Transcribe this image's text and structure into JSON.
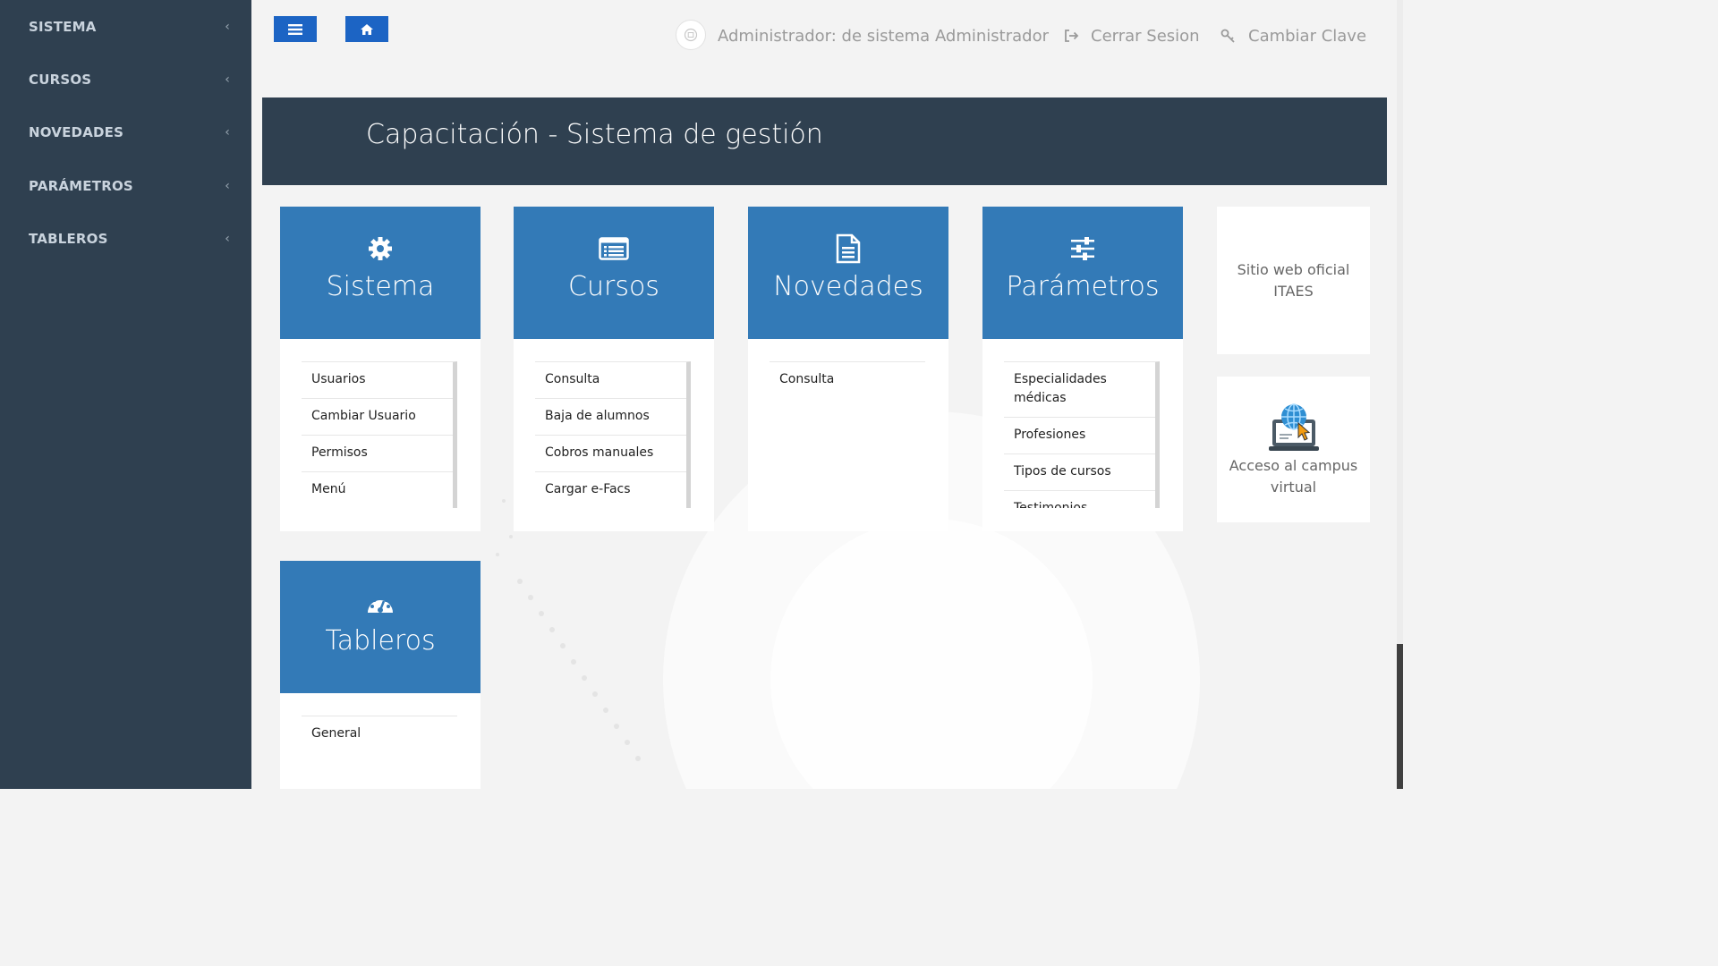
{
  "sidebar": {
    "items": [
      {
        "label": "SISTEMA"
      },
      {
        "label": "CURSOS"
      },
      {
        "label": "NOVEDADES"
      },
      {
        "label": "PARÁMETROS"
      },
      {
        "label": "TABLEROS"
      }
    ],
    "chevron": "‹"
  },
  "topbar": {
    "menu_icon": "bars-icon",
    "home_icon": "home-icon",
    "user_label": "Administrador: de sistema Administrador",
    "logout_label": "Cerrar Sesion",
    "change_password_label": "Cambiar Clave"
  },
  "header": {
    "title": "Capacitación - Sistema de gestión"
  },
  "modules": [
    {
      "title": "Sistema",
      "icon": "gear-icon",
      "items": [
        "Usuarios",
        "Cambiar Usuario",
        "Permisos",
        "Menú"
      ]
    },
    {
      "title": "Cursos",
      "icon": "list-alt-icon",
      "items": [
        "Consulta",
        "Baja de alumnos",
        "Cobros manuales",
        "Cargar e-Facs"
      ]
    },
    {
      "title": "Novedades",
      "icon": "file-text-icon",
      "items": [
        "Consulta"
      ]
    },
    {
      "title": "Parámetros",
      "icon": "sliders-icon",
      "items": [
        "Especialidades médicas",
        "Profesiones",
        "Tipos de cursos",
        "Testimonios"
      ]
    },
    {
      "title": "Tableros",
      "icon": "dashboard-icon",
      "items": [
        "General"
      ]
    }
  ],
  "links": {
    "website": "Sitio web oficial ITAES",
    "campus": "Acceso al campus virtual",
    "campus_icon": "laptop-globe-icon"
  },
  "colors": {
    "sidebar_bg": "#2f4050",
    "card_blue": "#337ab7",
    "button_blue": "#1c64c4"
  }
}
